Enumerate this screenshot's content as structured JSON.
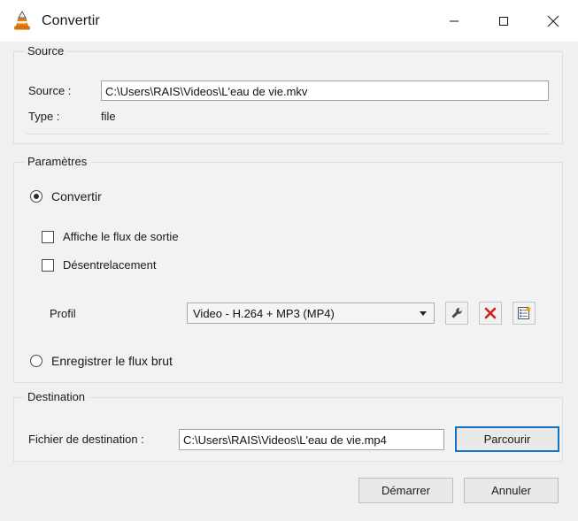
{
  "window": {
    "title": "Convertir",
    "icon": "vlc-cone-icon",
    "controls": {
      "minimize": "minimize-icon",
      "maximize": "maximize-icon",
      "close": "close-icon"
    }
  },
  "source_group": {
    "title": "Source",
    "source_label": "Source :",
    "source_value": "C:\\Users\\RAIS\\Videos\\L'eau de vie.mkv",
    "type_label": "Type :",
    "type_value": "file"
  },
  "params_group": {
    "title": "Paramètres",
    "convert_radio": {
      "label": "Convertir",
      "selected": true
    },
    "display_output_checkbox": {
      "label": "Affiche le flux de sortie",
      "checked": false
    },
    "deinterlace_checkbox": {
      "label": "Désentrelacement",
      "checked": false
    },
    "profile_label": "Profil",
    "profile_value": "Video - H.264 + MP3 (MP4)",
    "profile_buttons": [
      {
        "name": "edit-profile-button",
        "icon": "wrench-icon"
      },
      {
        "name": "delete-profile-button",
        "icon": "red-x-icon"
      },
      {
        "name": "new-profile-button",
        "icon": "new-list-icon"
      }
    ],
    "raw_stream_radio": {
      "label": "Enregistrer le flux brut",
      "selected": false
    }
  },
  "destination_group": {
    "title": "Destination",
    "file_label": "Fichier de destination :",
    "file_value": "C:\\Users\\RAIS\\Videos\\L'eau de vie.mp4",
    "browse_button": "Parcourir"
  },
  "footer": {
    "start_button": "Démarrer",
    "cancel_button": "Annuler"
  },
  "colors": {
    "accent_focus": "#1273c4",
    "delete_red": "#d02020",
    "badge_orange": "#f0a020",
    "dialog_bg": "#f0f0f0"
  }
}
